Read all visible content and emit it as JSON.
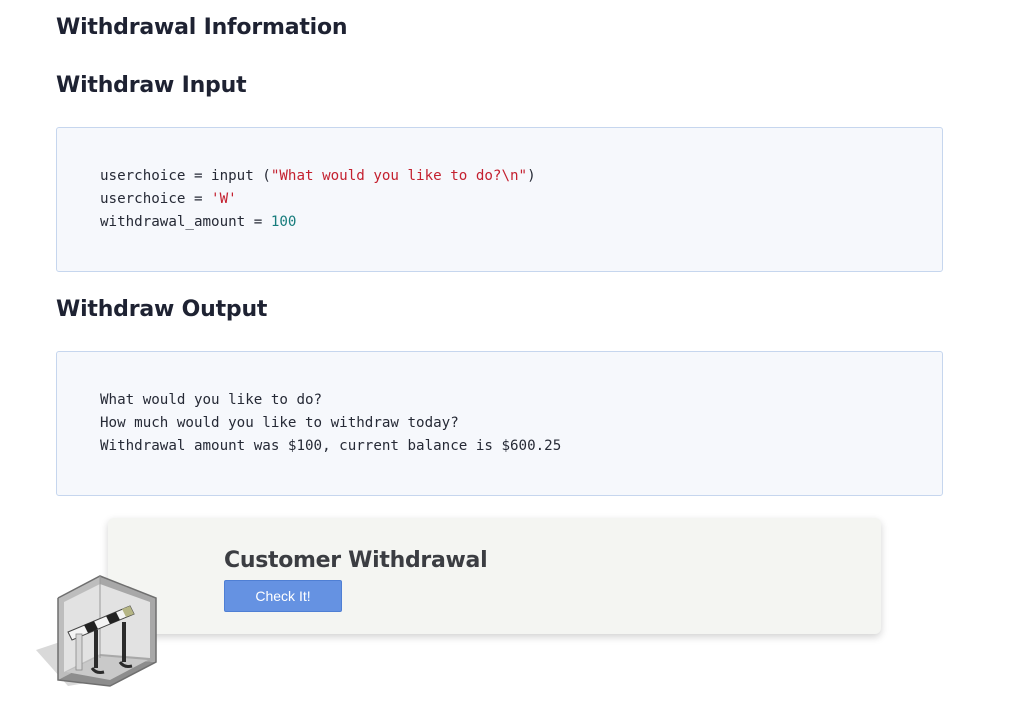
{
  "headings": {
    "info": "Withdrawal Information",
    "input": "Withdraw Input",
    "output": "Withdraw Output"
  },
  "input_code": {
    "line1": {
      "prefix": "userchoice = input (",
      "string": "\"What would you like to do?\\n\"",
      "suffix": ")"
    },
    "line2": {
      "prefix": "userchoice = ",
      "string": "'W'"
    },
    "line3": {
      "prefix": "withdrawal_amount = ",
      "number": "100"
    }
  },
  "output_lines": [
    "What would you like to do?",
    "How much would you like to withdraw today?",
    "Withdrawal amount was $100, current balance is $600.25"
  ],
  "card": {
    "title": "Customer Withdrawal",
    "button_label": "Check It!"
  },
  "colors": {
    "string": "#c4202f",
    "number": "#177c7c",
    "button": "#6592e2",
    "code_border": "#c6d6ee"
  },
  "icons": {
    "illustration": "atm-cube-illustration"
  }
}
